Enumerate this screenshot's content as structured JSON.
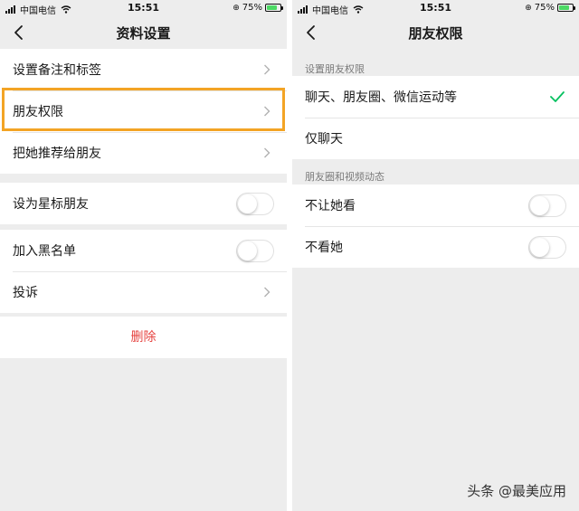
{
  "status_bar": {
    "carrier": "中国电信",
    "time": "15:51",
    "battery": "75%",
    "battery_level": 0.75
  },
  "left_screen": {
    "title": "资料设置",
    "group1": [
      {
        "label": "设置备注和标签"
      },
      {
        "label": "朋友权限"
      },
      {
        "label": "把她推荐给朋友"
      }
    ],
    "group2": [
      {
        "label": "设为星标朋友",
        "toggle": false
      }
    ],
    "group3": [
      {
        "label": "加入黑名单",
        "toggle": false
      },
      {
        "label": "投诉"
      }
    ],
    "delete_label": "删除"
  },
  "right_screen": {
    "title": "朋友权限",
    "section1_header": "设置朋友权限",
    "section1_items": [
      {
        "label": "聊天、朋友圈、微信运动等",
        "selected": true
      },
      {
        "label": "仅聊天",
        "selected": false
      }
    ],
    "section2_header": "朋友圈和视频动态",
    "section2_items": [
      {
        "label": "不让她看",
        "toggle": false
      },
      {
        "label": "不看她",
        "toggle": false
      }
    ]
  },
  "watermark": "头条 @最美应用",
  "colors": {
    "highlight": "#f3a425",
    "delete": "#e64340",
    "check": "#07c160",
    "background": "#ededed"
  }
}
